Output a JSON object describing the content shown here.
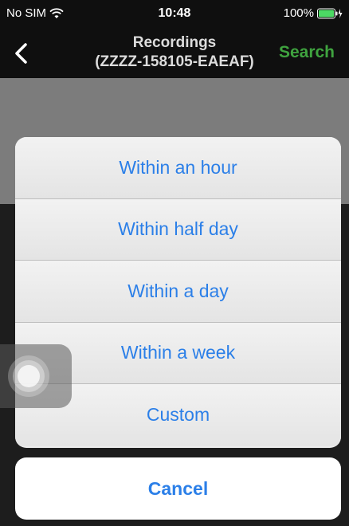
{
  "status_bar": {
    "carrier": "No SIM",
    "time": "10:48",
    "battery": "100%",
    "wifi_icon": "wifi-icon",
    "battery_icon": "battery-charging-icon"
  },
  "nav": {
    "back_icon": "chevron-left-icon",
    "title_line1": "Recordings",
    "title_line2": "(ZZZZ-158105-EAEAF)",
    "search_label": "Search"
  },
  "action_sheet": {
    "options": [
      {
        "label": "Within an hour"
      },
      {
        "label": "Within half day"
      },
      {
        "label": "Within a day"
      },
      {
        "label": "Within a week"
      },
      {
        "label": "Custom"
      }
    ],
    "cancel_label": "Cancel"
  },
  "colors": {
    "accent_blue": "#2b7fe8",
    "search_green": "#3fa33f"
  }
}
